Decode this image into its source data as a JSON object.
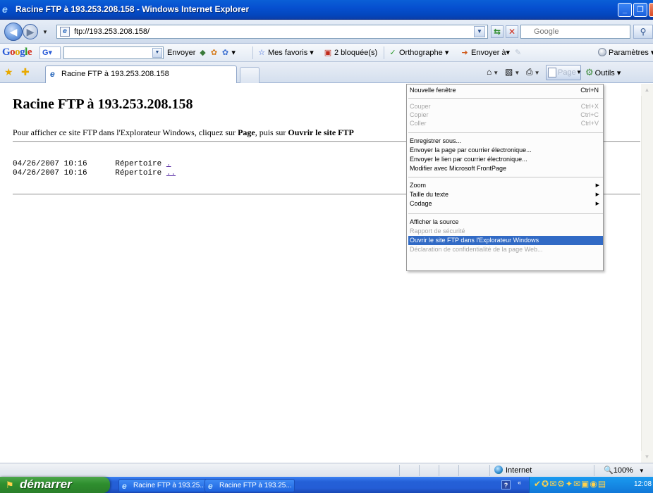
{
  "window": {
    "title": "Racine FTP à 193.253.208.158 - Windows Internet Explorer",
    "min_label": "_",
    "max_label": "❐",
    "close_label": "X"
  },
  "address_bar": {
    "url": "ftp://193.253.208.158/",
    "search_placeholder": "Google"
  },
  "google_toolbar": {
    "logo": [
      "G",
      "o",
      "o",
      "g",
      "l",
      "e"
    ],
    "menu_label": "G▾",
    "envoyer": "Envoyer",
    "mes_favoris": "Mes favoris ▾",
    "bloquees": "2 bloquée(s)",
    "orthographe": "Orthographe ▾",
    "envoyer_a": "Envoyer à▾",
    "parametres": "Paramètres ▾"
  },
  "tabs": {
    "active_label": "Racine FTP à 193.253.208.158"
  },
  "command_bar": {
    "page_label": "Page",
    "outils_label": "Outils ▾"
  },
  "page": {
    "heading": "Racine FTP à 193.253.208.158",
    "instruction_prefix": "Pour afficher ce site FTP dans l'Explorateur Windows, cliquez sur ",
    "instruction_page": "Page",
    "instruction_middle": ", puis sur ",
    "instruction_open": "Ouvrir le site FTP",
    "listing": [
      {
        "date": "04/26/2007 10:16",
        "type": "Répertoire",
        "name": "."
      },
      {
        "date": "04/26/2007 10:16",
        "type": "Répertoire",
        "name": ".."
      }
    ]
  },
  "menu": {
    "items": [
      {
        "label": "Nouvelle fenêtre",
        "shortcut": "Ctrl+N",
        "disabled": false
      },
      {
        "label": "Couper",
        "shortcut": "Ctrl+X",
        "disabled": true
      },
      {
        "label": "Copier",
        "shortcut": "Ctrl+C",
        "disabled": true
      },
      {
        "label": "Coller",
        "shortcut": "Ctrl+V",
        "disabled": true
      },
      {
        "label": "Enregistrer sous...",
        "disabled": false
      },
      {
        "label": "Envoyer la page par courrier électronique...",
        "disabled": false
      },
      {
        "label": "Envoyer le lien par courrier électronique...",
        "disabled": false
      },
      {
        "label": "Modifier avec Microsoft FrontPage",
        "disabled": false
      },
      {
        "label": "Zoom",
        "submenu": true,
        "disabled": false
      },
      {
        "label": "Taille du texte",
        "submenu": true,
        "disabled": false
      },
      {
        "label": "Codage",
        "submenu": true,
        "disabled": false
      },
      {
        "label": "Afficher la source",
        "disabled": false
      },
      {
        "label": "Rapport de sécurité",
        "disabled": true
      },
      {
        "label": "Ouvrir le site FTP dans l'Explorateur Windows",
        "disabled": false,
        "highlighted": true
      },
      {
        "label": "Déclaration de confidentialité de la page Web...",
        "disabled": true
      }
    ]
  },
  "status_bar": {
    "zone": "Internet",
    "zoom": "100%"
  },
  "taskbar": {
    "start_label": "démarrer",
    "item1": "Racine FTP à 193.25...",
    "item2": "Racine FTP à 193.25...",
    "clock": "12:08"
  },
  "colors": {
    "titlebar": "#0650d0",
    "menu_highlight": "#316ac5",
    "start_button": "#2e8e2e",
    "link_visited": "#5a2ea6"
  }
}
